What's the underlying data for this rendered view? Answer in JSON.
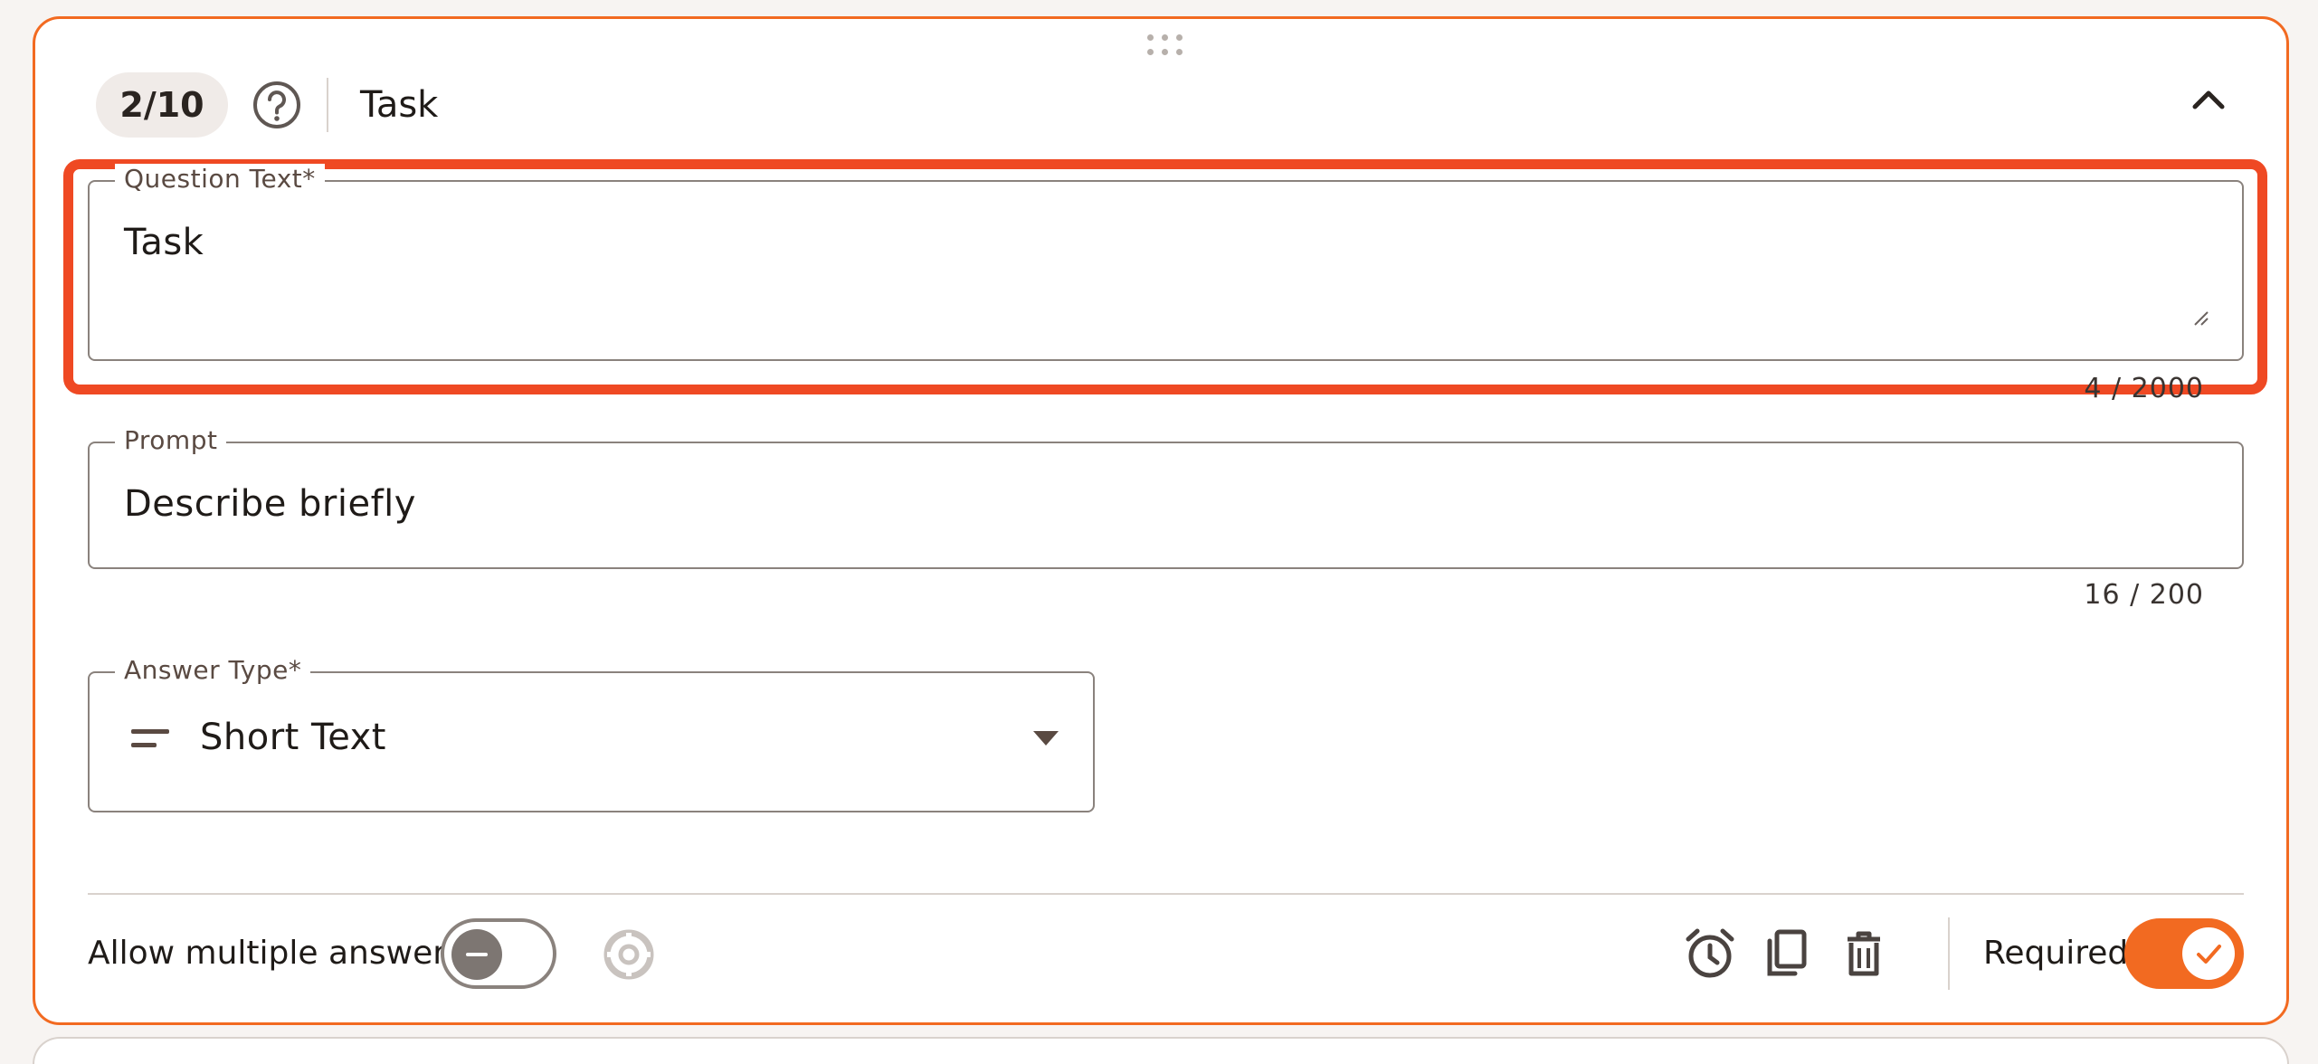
{
  "question_card": {
    "counter": "2/10",
    "title": "Task",
    "question_text": {
      "label": "Question Text*",
      "value": "Task",
      "char_count": "4 / 2000"
    },
    "prompt": {
      "label": "Prompt",
      "value": "Describe briefly",
      "char_count": "16 / 200"
    },
    "answer_type": {
      "label": "Answer Type*",
      "selected": "Short Text",
      "icon": "short-text-icon"
    },
    "footer": {
      "allow_multiple_label": "Allow multiple answers",
      "allow_multiple_enabled": false,
      "required_label": "Required",
      "required_enabled": true
    }
  },
  "colors": {
    "accent": "#f26a21",
    "highlight": "#ef4923",
    "border": "#8a827d"
  }
}
